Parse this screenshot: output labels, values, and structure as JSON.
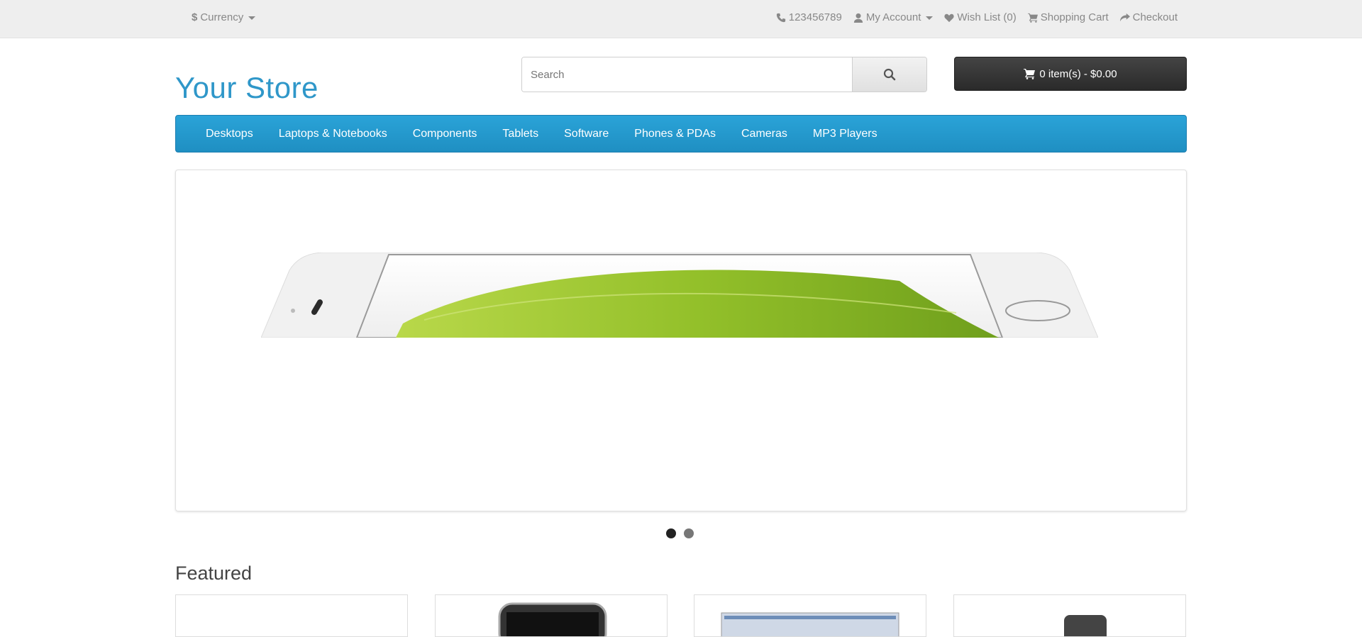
{
  "topbar": {
    "currency_symbol": "$",
    "currency_label": "Currency",
    "phone": "123456789",
    "my_account": "My Account",
    "wishlist": "Wish List (0)",
    "shopping_cart": "Shopping Cart",
    "checkout": "Checkout"
  },
  "header": {
    "logo": "Your Store",
    "search_placeholder": "Search",
    "cart_summary": "0 item(s) - $0.00"
  },
  "menu": {
    "items": [
      {
        "label": "Desktops"
      },
      {
        "label": "Laptops & Notebooks"
      },
      {
        "label": "Components"
      },
      {
        "label": "Tablets"
      },
      {
        "label": "Software"
      },
      {
        "label": "Phones & PDAs"
      },
      {
        "label": "Cameras"
      },
      {
        "label": "MP3 Players"
      }
    ]
  },
  "slideshow": {
    "slide_count": 2,
    "active_index": 0
  },
  "featured": {
    "heading": "Featured"
  },
  "colors": {
    "accent": "#2f97c9",
    "menu_bg": "#229ad0",
    "cart_bg": "#333333"
  }
}
